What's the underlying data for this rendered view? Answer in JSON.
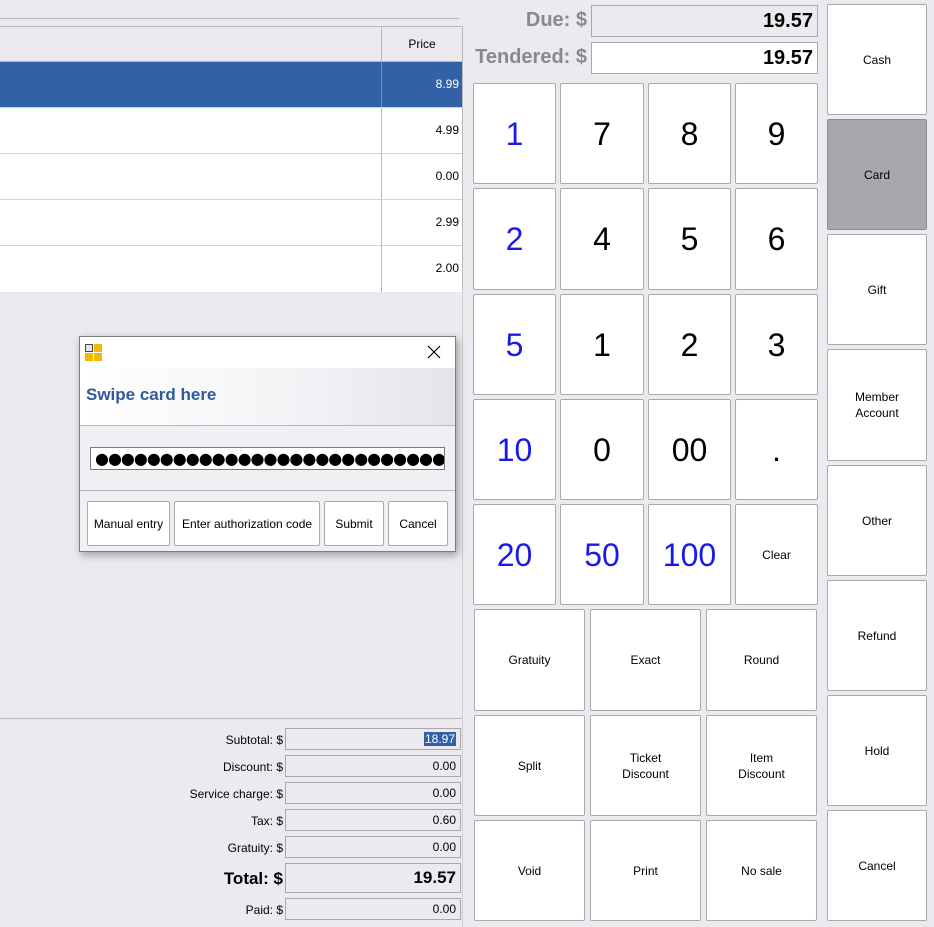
{
  "order_table": {
    "price_header": "Price",
    "rows": [
      {
        "price": "8.99",
        "selected": true
      },
      {
        "price": "4.99"
      },
      {
        "price": "0.00"
      },
      {
        "price": "2.99"
      },
      {
        "price": "2.00"
      }
    ]
  },
  "totals": {
    "subtotal_label": "Subtotal: $",
    "subtotal": "18.97",
    "discount_label": "Discount: $",
    "discount": "0.00",
    "service_label": "Service charge: $",
    "service": "0.00",
    "tax_label": "Tax: $",
    "tax": "0.60",
    "gratuity_label": "Gratuity: $",
    "gratuity": "0.00",
    "total_label": "Total: $",
    "total": "19.57",
    "paid_label": "Paid: $",
    "paid": "0.00"
  },
  "payment": {
    "due_label": "Due: $",
    "due": "19.57",
    "tendered_label": "Tendered: $",
    "tendered": "19.57"
  },
  "keypad": {
    "quick": [
      "1",
      "2",
      "5",
      "10",
      "20"
    ],
    "digits": [
      "7",
      "8",
      "9",
      "4",
      "5",
      "6",
      "1",
      "2",
      "3",
      "0",
      "00",
      "."
    ],
    "big": [
      "50",
      "100"
    ],
    "clear": "Clear"
  },
  "actions": {
    "gratuity": "Gratuity",
    "exact": "Exact",
    "round": "Round",
    "split": "Split",
    "ticket_discount": "Ticket\nDiscount",
    "item_discount": "Item\nDiscount",
    "void": "Void",
    "print": "Print",
    "no_sale": "No sale"
  },
  "tenders": {
    "cash": "Cash",
    "card": "Card",
    "gift": "Gift",
    "member": "Member\nAccount",
    "other": "Other",
    "refund": "Refund",
    "hold": "Hold",
    "cancel": "Cancel"
  },
  "dialog": {
    "heading": "Swipe card here",
    "masked_input": "●●●●●●●●●●●●●●●●●●●●●●●●●●●●●●●",
    "buttons": {
      "manual": "Manual entry",
      "auth": "Enter authorization code",
      "submit": "Submit",
      "cancel": "Cancel"
    }
  },
  "colors": {
    "selected_row": "#3162A8",
    "blue_quick_amount": "#1A1AE8",
    "pressed_button": "#A9A7AC",
    "dialog_heading": "#2F5A9E"
  },
  "icons": {
    "app": "app-icon",
    "close": "close-icon"
  }
}
